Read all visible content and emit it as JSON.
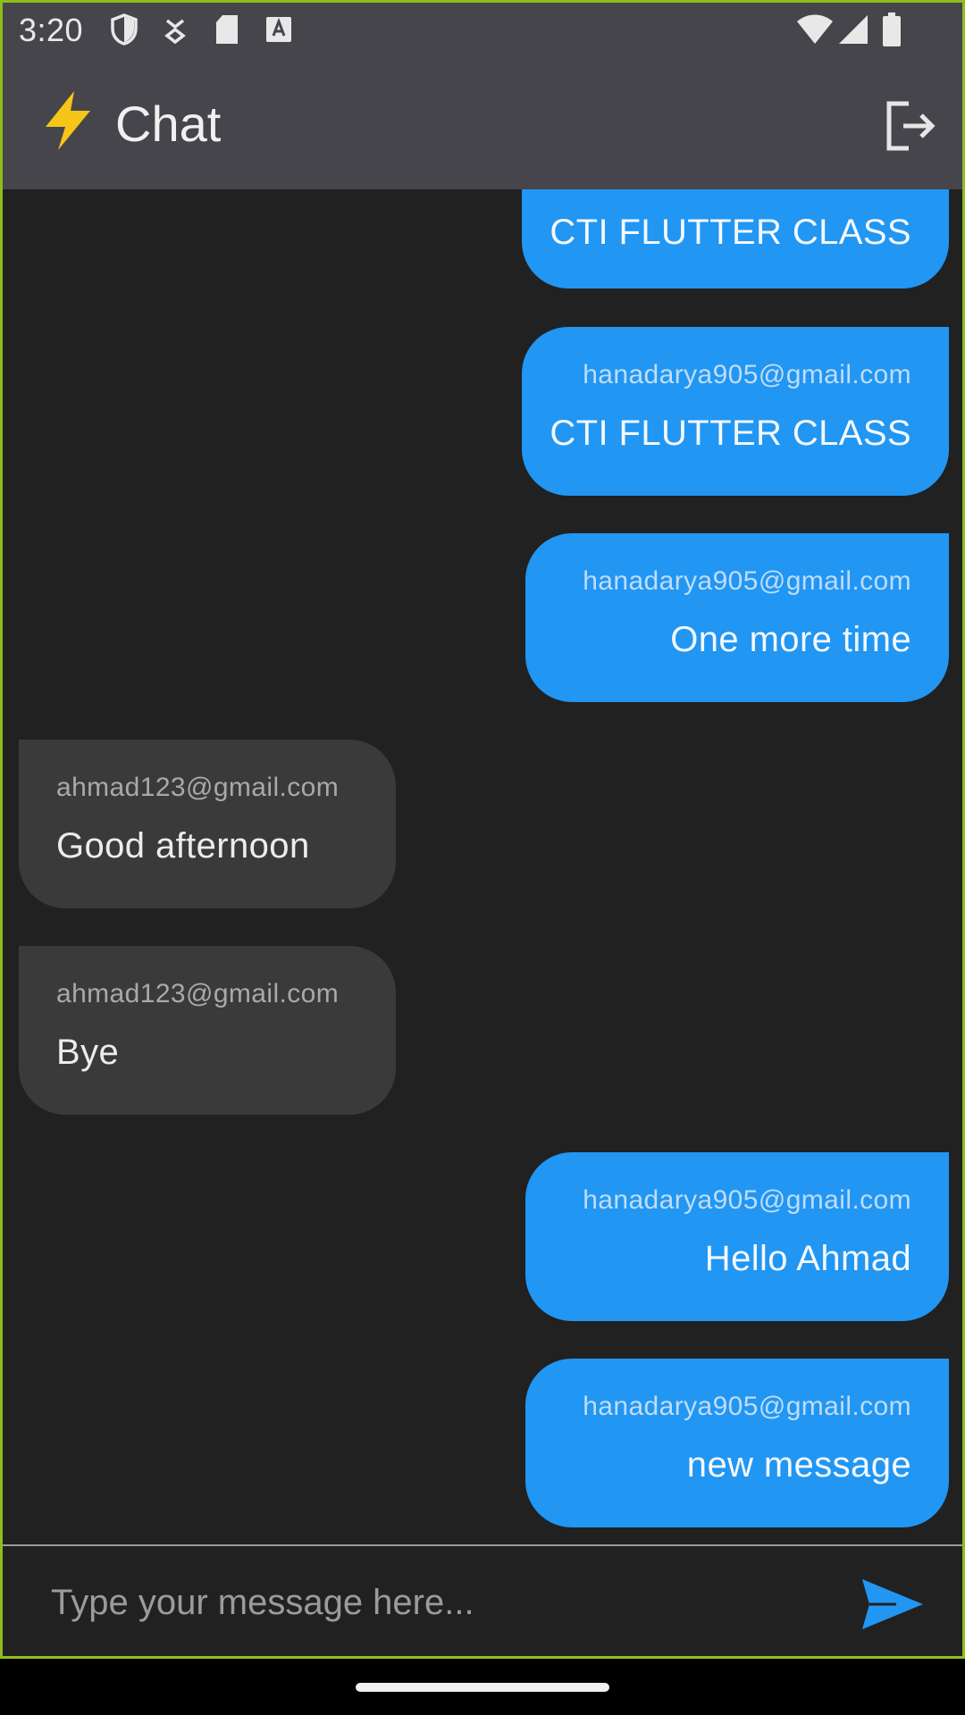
{
  "status_bar": {
    "time": "3:20",
    "left_icons": [
      "shield-icon",
      "usb-debug-icon",
      "sd-card-icon",
      "text-icon"
    ],
    "right_icons": [
      "wifi-icon",
      "signal-icon",
      "battery-icon"
    ]
  },
  "app_bar": {
    "icon": "lightning-icon",
    "title": "Chat",
    "action_icon": "logout-icon",
    "background": "#46454b"
  },
  "messages": [
    {
      "sender": "",
      "text": "CTI FLUTTER CLASS",
      "is_me": true
    },
    {
      "sender": "hanadarya905@gmail.com",
      "text": "CTI FLUTTER CLASS",
      "is_me": true
    },
    {
      "sender": "hanadarya905@gmail.com",
      "text": "One more time",
      "is_me": true
    },
    {
      "sender": "ahmad123@gmail.com",
      "text": "Good afternoon",
      "is_me": false
    },
    {
      "sender": "ahmad123@gmail.com",
      "text": "Bye",
      "is_me": false
    },
    {
      "sender": "hanadarya905@gmail.com",
      "text": "Hello Ahmad",
      "is_me": true
    },
    {
      "sender": "hanadarya905@gmail.com",
      "text": "new message",
      "is_me": true
    }
  ],
  "composer": {
    "placeholder": "Type your message here...",
    "value": "",
    "send_icon": "send-icon"
  },
  "colors": {
    "my_bubble": "#2196f3",
    "other_bubble": "#3a3a3a",
    "background": "#212121",
    "accent_bolt": "#f5c518"
  }
}
